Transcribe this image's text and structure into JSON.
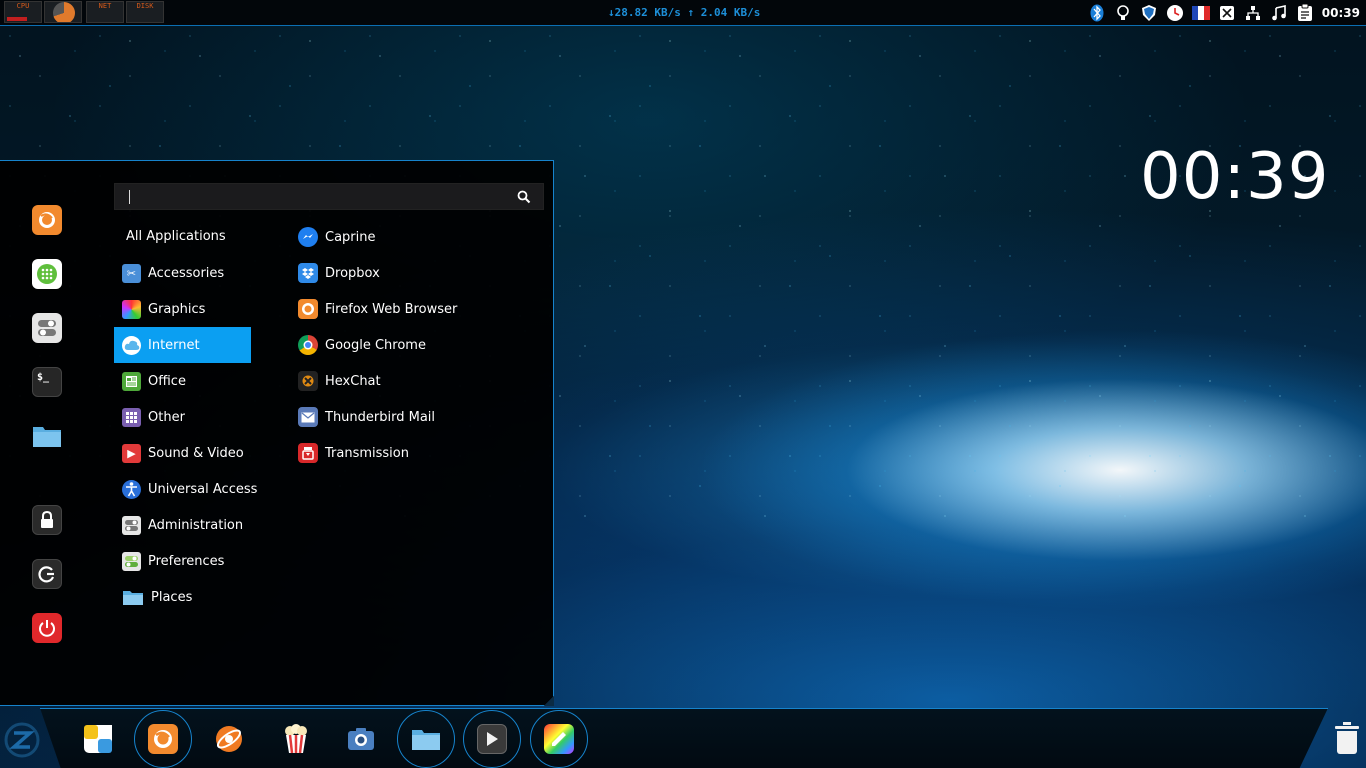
{
  "top_panel": {
    "monitors": [
      {
        "label": "CPU",
        "color": "#d65a1a"
      },
      {
        "label": "",
        "color": "#e07a2c"
      },
      {
        "label": "NET",
        "color": "#d65a1a"
      },
      {
        "label": "DISK",
        "color": "#d65a1a"
      }
    ],
    "net_speed": "↓28.82 KB/s ↑ 2.04 KB/s",
    "tray_icons": [
      "bluetooth-icon",
      "bulb-icon",
      "shield-icon",
      "clock-app-icon",
      "flag-fr-icon",
      "screenshot-icon",
      "network-icon",
      "music-icon",
      "clipboard-icon"
    ],
    "clock": "00:39"
  },
  "desktop": {
    "clock": "00:39"
  },
  "menu": {
    "search": {
      "value": "",
      "placeholder": ""
    },
    "favorites": [
      {
        "name": "firefox",
        "color": "#f28a2e"
      },
      {
        "name": "software",
        "color": "#5fbf3c"
      },
      {
        "name": "settings",
        "color": "#cfcfcf"
      },
      {
        "name": "terminal",
        "color": "#222222"
      },
      {
        "name": "files",
        "color": "#5aaee0"
      },
      {
        "name": "lock",
        "color": "#2a2a2a"
      },
      {
        "name": "logout",
        "color": "#2a2a2a"
      },
      {
        "name": "shutdown",
        "color": "#e0282b"
      }
    ],
    "all_applications": "All Applications",
    "categories": [
      {
        "label": "Accessories",
        "icon": "scissors-icon",
        "color": "#4a8fd8"
      },
      {
        "label": "Graphics",
        "icon": "graphics-icon",
        "color": "#c83ad8"
      },
      {
        "label": "Internet",
        "icon": "cloud-icon",
        "color": "#5ab6ec",
        "active": true
      },
      {
        "label": "Office",
        "icon": "office-icon",
        "color": "#4ea83a"
      },
      {
        "label": "Other",
        "icon": "grid-icon",
        "color": "#7a5fb0"
      },
      {
        "label": "Sound & Video",
        "icon": "play-icon",
        "color": "#e23a3a"
      },
      {
        "label": "Universal Access",
        "icon": "accessibility-icon",
        "color": "#2a6fd8"
      },
      {
        "label": "Administration",
        "icon": "admin-icon",
        "color": "#b8b8b8"
      },
      {
        "label": "Preferences",
        "icon": "preferences-icon",
        "color": "#9bd06a"
      },
      {
        "label": "Places",
        "icon": "folder-icon",
        "color": "#6ab6e8"
      }
    ],
    "apps": [
      {
        "label": "Caprine",
        "icon": "caprine-icon",
        "color": "#1f7ff0"
      },
      {
        "label": "Dropbox",
        "icon": "dropbox-icon",
        "color": "#2f8ae8"
      },
      {
        "label": "Firefox Web Browser",
        "icon": "firefox-icon",
        "color": "#f28a2e"
      },
      {
        "label": "Google Chrome",
        "icon": "chrome-icon",
        "color": "#dd4433"
      },
      {
        "label": "HexChat",
        "icon": "hexchat-icon",
        "color": "#e08a12"
      },
      {
        "label": "Thunderbird Mail",
        "icon": "mail-icon",
        "color": "#5a7ab8"
      },
      {
        "label": "Transmission",
        "icon": "transmission-icon",
        "color": "#d8282a"
      }
    ]
  },
  "dock": {
    "items": [
      {
        "name": "software-center",
        "color": "#f4c21a",
        "ring": false
      },
      {
        "name": "firefox",
        "color": "#f28a2e",
        "ring": true
      },
      {
        "name": "web-browser",
        "color": "#f07a22",
        "ring": false
      },
      {
        "name": "popcorn-time",
        "color": "#e8e8e8",
        "ring": false
      },
      {
        "name": "screenshot",
        "color": "#4a7fc0",
        "ring": false
      },
      {
        "name": "files",
        "color": "#6ab6e8",
        "ring": true
      },
      {
        "name": "media-player",
        "color": "#3a3a3a",
        "ring": true
      },
      {
        "name": "draw",
        "color": "#c83ad8",
        "ring": true
      }
    ]
  }
}
